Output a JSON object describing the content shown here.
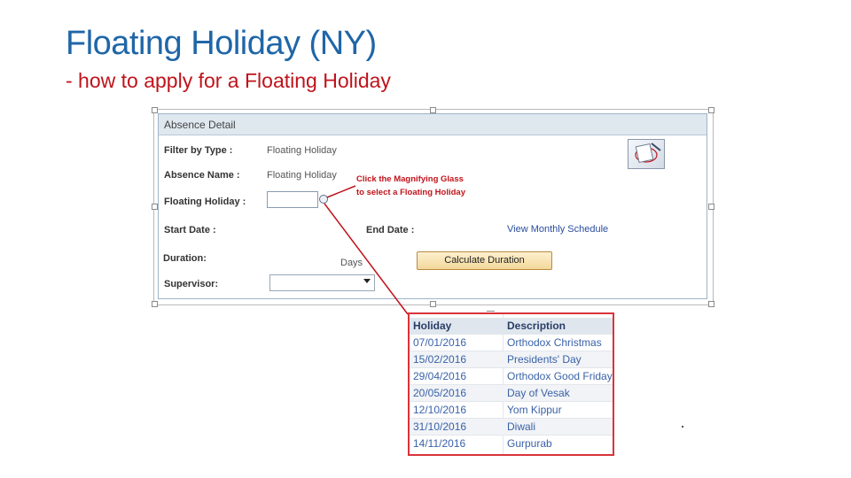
{
  "slide": {
    "title": "Floating Holiday (NY)",
    "subtitle": "- how to apply for a Floating Holiday"
  },
  "panel": {
    "header": "Absence Detail",
    "filter_label": "Filter by Type :",
    "filter_value": "Floating Holiday",
    "absence_name_label": "Absence Name :",
    "absence_name_value": "Floating Holiday",
    "floating_holiday_label": "Floating Holiday :",
    "floating_holiday_value": "",
    "start_date_label": "Start Date :",
    "end_date_label": "End Date :",
    "view_schedule_link": "View Monthly Schedule",
    "duration_label": "Duration:",
    "duration_unit": "Days",
    "calculate_button": "Calculate Duration",
    "supervisor_label": "Supervisor:",
    "supervisor_value": ""
  },
  "callout": {
    "line1": "Click the Magnifying Glass",
    "line2": "to select a Floating Holiday"
  },
  "lookup": {
    "headers": {
      "holiday": "Holiday",
      "description": "Description"
    },
    "rows": [
      {
        "date": "07/01/2016",
        "desc": "Orthodox Christmas"
      },
      {
        "date": "15/02/2016",
        "desc": "Presidents' Day"
      },
      {
        "date": "29/04/2016",
        "desc": "Orthodox Good Friday"
      },
      {
        "date": "20/05/2016",
        "desc": "Day of Vesak"
      },
      {
        "date": "12/10/2016",
        "desc": "Yom Kippur"
      },
      {
        "date": "31/10/2016",
        "desc": "Diwali"
      },
      {
        "date": "14/11/2016",
        "desc": "Gurpurab"
      }
    ]
  },
  "colors": {
    "title": "#1f66a8",
    "subtitle": "#c0131a",
    "callout": "#c0131a",
    "popup_border": "#d9333a",
    "link": "#2a4c9c"
  },
  "icons": {
    "lookup": "magnifying-glass-icon",
    "document": "document-icon",
    "dropdown": "chevron-down-icon"
  }
}
